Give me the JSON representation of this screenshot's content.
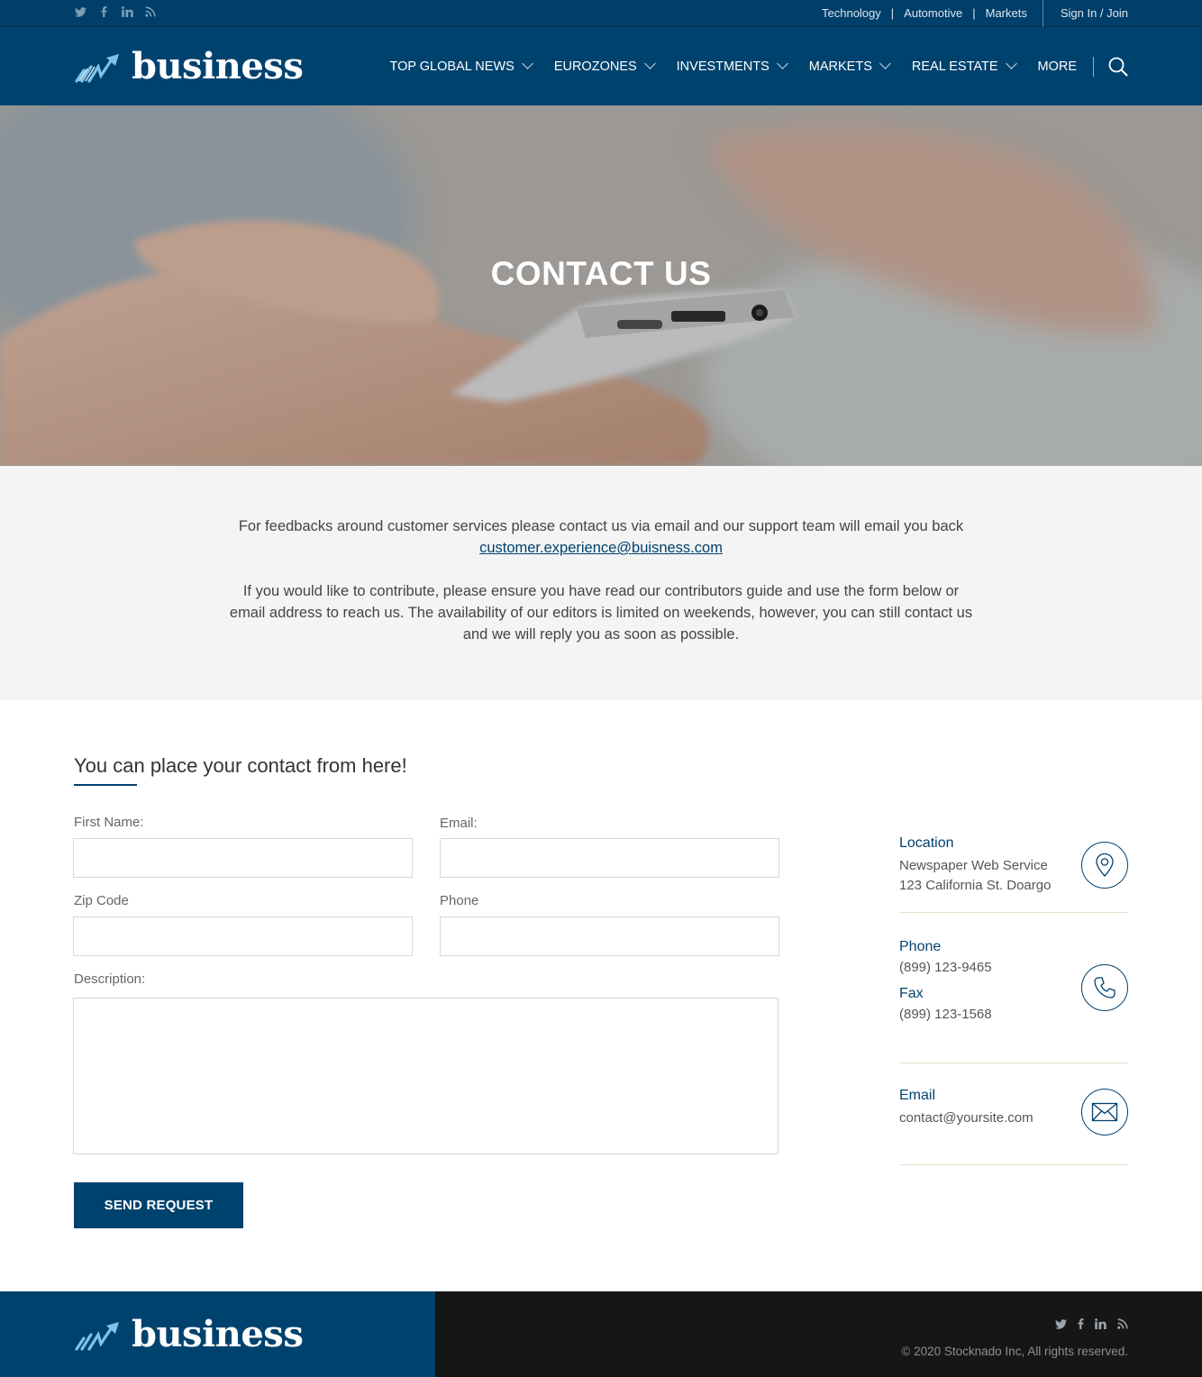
{
  "topbar": {
    "social": [
      "twitter-icon",
      "facebook-icon",
      "linkedin-icon",
      "rss-icon"
    ],
    "links": [
      "Technology",
      "Automotive",
      "Markets"
    ],
    "signin": "Sign In / Join"
  },
  "header": {
    "logo_text": "business",
    "nav": [
      {
        "label": "TOP GLOBAL NEWS"
      },
      {
        "label": "EUROZONES"
      },
      {
        "label": "INVESTMENTS"
      },
      {
        "label": "MARKETS"
      },
      {
        "label": "REAL ESTATE"
      }
    ],
    "more": "MORE"
  },
  "hero": {
    "title": "CONTACT US"
  },
  "intro": {
    "p1": "For feedbacks around customer services please contact us via email and our support team will email you back",
    "p1_email": "customer.experience@buisness.com",
    "p2": "If you would like to contribute, please ensure you have read our contributors guide and use the form below or email address to reach us. The availability of our editors is limited on weekends, however, you can still contact us and we will reply you as soon as possible."
  },
  "form": {
    "title": "You can place your contact from here!",
    "first_name_label": "First Name:",
    "email_label": "Email:",
    "zip_label": "Zip Code",
    "phone_label": "Phone",
    "description_label": "Description:",
    "first_name_value": "",
    "email_value": "",
    "zip_value": "",
    "phone_value": "",
    "description_value": "",
    "submit": "SEND REQUEST"
  },
  "info": {
    "location_title": "Location",
    "location_line1": "Newspaper Web Service",
    "location_line2": "123 California St. Doargo",
    "phone_title": "Phone",
    "phone_value": "(899) 123-9465",
    "fax_title": "Fax",
    "fax_value": "(899) 123-1568",
    "email_title": "Email",
    "email_value": "contact@yoursite.com"
  },
  "footer": {
    "logo_text": "business",
    "copyright": "© 2020 Stocknado Inc, All rights reserved."
  },
  "colors": {
    "brand": "#00426e",
    "footer_dark": "#161616",
    "intro_bg": "#f4f4f4"
  }
}
